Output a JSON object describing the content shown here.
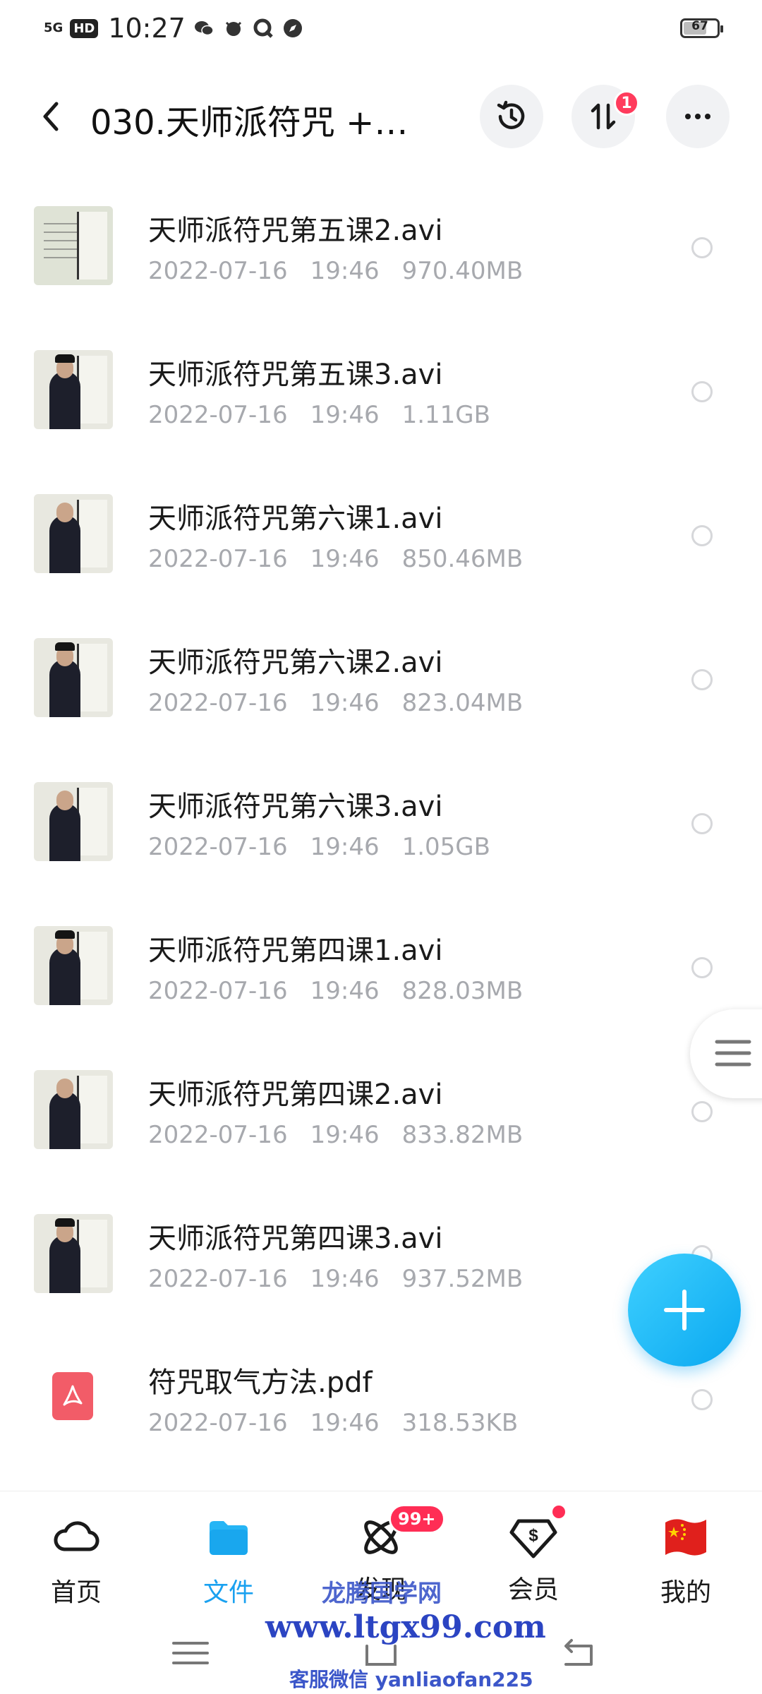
{
  "status_bar": {
    "network": "5G",
    "hd": "HD",
    "time": "10:27",
    "battery_level": "67"
  },
  "header": {
    "title": "030.天师派符咒 +…",
    "transfer_badge": "1",
    "icons": [
      "chevron-left-icon",
      "history-icon",
      "sort-transfer-icon",
      "more-icon"
    ]
  },
  "files": [
    {
      "name": "天师派符咒第五课2.avi",
      "date": "2022-07-16",
      "time": "19:46",
      "size": "970.40MB",
      "type": "video"
    },
    {
      "name": "天师派符咒第五课3.avi",
      "date": "2022-07-16",
      "time": "19:46",
      "size": "1.11GB",
      "type": "video"
    },
    {
      "name": "天师派符咒第六课1.avi",
      "date": "2022-07-16",
      "time": "19:46",
      "size": "850.46MB",
      "type": "video"
    },
    {
      "name": "天师派符咒第六课2.avi",
      "date": "2022-07-16",
      "time": "19:46",
      "size": "823.04MB",
      "type": "video"
    },
    {
      "name": "天师派符咒第六课3.avi",
      "date": "2022-07-16",
      "time": "19:46",
      "size": "1.05GB",
      "type": "video"
    },
    {
      "name": "天师派符咒第四课1.avi",
      "date": "2022-07-16",
      "time": "19:46",
      "size": "828.03MB",
      "type": "video"
    },
    {
      "name": "天师派符咒第四课2.avi",
      "date": "2022-07-16",
      "time": "19:46",
      "size": "833.82MB",
      "type": "video"
    },
    {
      "name": "天师派符咒第四课3.avi",
      "date": "2022-07-16",
      "time": "19:46",
      "size": "937.52MB",
      "type": "video"
    },
    {
      "name": "符咒取气方法.pdf",
      "date": "2022-07-16",
      "time": "19:46",
      "size": "318.53KB",
      "type": "pdf"
    }
  ],
  "bottom_nav": [
    {
      "label": "首页",
      "icon": "cloud-icon"
    },
    {
      "label": "文件",
      "icon": "folder-icon",
      "active": true
    },
    {
      "label": "发现",
      "icon": "atom-icon",
      "badge": "99+"
    },
    {
      "label": "会员",
      "icon": "vip-diamond-icon",
      "dot": true
    },
    {
      "label": "我的",
      "icon": "china-flag-avatar-icon"
    }
  ],
  "watermark": {
    "line1": "龙腾国学网",
    "line2": "www.ltgx99.com",
    "line3": "客服微信 yanliaofan225"
  },
  "colors": {
    "accent": "#1aa1f0",
    "badge": "#ff2d55",
    "meta_text": "#a7a9ae",
    "pdf": "#f25c68"
  }
}
